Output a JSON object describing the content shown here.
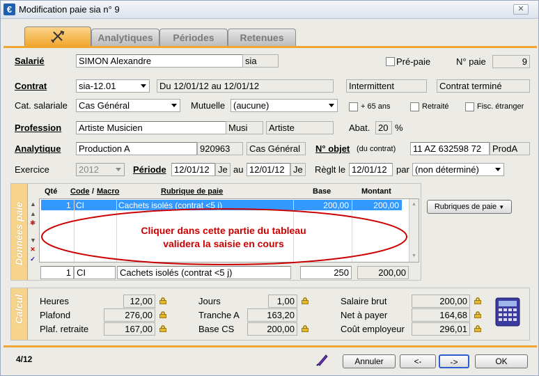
{
  "window": {
    "title": "Modification paie sia n° 9",
    "close_glyph": "✕"
  },
  "tabs": [
    {
      "label": "",
      "icon": "tools-icon"
    },
    {
      "label": "Analytiques"
    },
    {
      "label": "Périodes"
    },
    {
      "label": "Retenues"
    }
  ],
  "salarie": {
    "label": "Salarié",
    "name": "SIMON Alexandre",
    "code": "sia",
    "prepaie_label": "Pré-paie",
    "npaie_label": "N° paie",
    "npaie": "9"
  },
  "contrat": {
    "label": "Contrat",
    "value": "sia-12.01",
    "dates": "Du 12/01/12 au 12/01/12",
    "type": "Intermittent",
    "status": "Contrat terminé"
  },
  "cat": {
    "label": "Cat. salariale",
    "value": "Cas Général",
    "mutuelle_label": "Mutuelle",
    "mutuelle": "(aucune)",
    "plus65": "+ 65 ans",
    "retraite": "Retraité",
    "fisc": "Fisc. étranger"
  },
  "profession": {
    "label": "Profession",
    "value": "Artiste Musicien",
    "short": "Musi",
    "category": "Artiste",
    "abat_label": "Abat.",
    "abat": "20",
    "pct": "%"
  },
  "analytique": {
    "label": "Analytique",
    "value": "Production A",
    "code": "920963",
    "cat": "Cas Général",
    "nobjet_label": "N° objet",
    "nobjet_sub": "(du contrat)",
    "nobjet": "11 AZ 632598 72",
    "nobjet_code": "ProdA"
  },
  "exercice": {
    "label": "Exercice",
    "year": "2012",
    "periode_label": "Période",
    "from": "12/01/12",
    "from_day": "Je",
    "au": "au",
    "to": "12/01/12",
    "to_day": "Je",
    "reglt_label": "Règlt le",
    "reglt": "12/01/12",
    "par": "par",
    "mode": "(non déterminé)"
  },
  "donnees": {
    "side_label": "Données paie",
    "headers": {
      "qte": "Qté",
      "code": "Code",
      "macro": "Macro",
      "rubrique": "Rubrique de paie",
      "base": "Base",
      "montant": "Montant"
    },
    "rows": [
      {
        "qte": "1",
        "code": "CI",
        "rubrique": "Cachets isolés (contrat <5 j)",
        "base": "200,00",
        "montant": "200,00"
      }
    ],
    "annotation": "Cliquer dans cette partie du tableau validera la saisie en cours",
    "edit": {
      "qte": "1",
      "code": "CI",
      "rubrique": "Cachets isolés (contrat <5 j)",
      "base": "250",
      "montant": "200,00"
    },
    "rubriques_button": "Rubriques de paie"
  },
  "calcul": {
    "side_label": "Calcul",
    "heures_label": "Heures",
    "heures": "12,00",
    "plafond_label": "Plafond",
    "plafond": "276,00",
    "plafret_label": "Plaf. retraite",
    "plafret": "167,00",
    "jours_label": "Jours",
    "jours": "1,00",
    "tranche_label": "Tranche A",
    "tranche": "163,20",
    "basecs_label": "Base CS",
    "basecs": "200,00",
    "brut_label": "Salaire brut",
    "brut": "200,00",
    "net_label": "Net à payer",
    "net": "164,68",
    "cout_label": "Coût employeur",
    "cout": "296,01"
  },
  "footer": {
    "page": "4/12",
    "annuler": "Annuler",
    "prev": "<-",
    "next": "->",
    "ok": "OK"
  },
  "colors": {
    "accent": "#f2a530",
    "selection": "#3399ff",
    "annotation": "#cc0000"
  }
}
